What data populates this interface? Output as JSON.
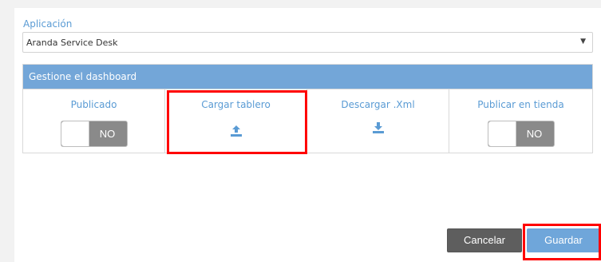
{
  "application": {
    "label": "Aplicación",
    "selected_value": "Aranda Service Desk",
    "arrow": "▼"
  },
  "dashboard_section": {
    "title": "Gestione el dashboard",
    "columns": [
      {
        "label": "Publicado",
        "control": "toggle",
        "toggle_state": "NO"
      },
      {
        "label": "Cargar tablero",
        "control": "icon",
        "icon": "upload-icon"
      },
      {
        "label": "Descargar .Xml",
        "control": "icon",
        "icon": "download-icon"
      },
      {
        "label": "Publicar en tienda",
        "control": "toggle",
        "toggle_state": "NO"
      }
    ]
  },
  "buttons": {
    "cancel": "Cancelar",
    "save": "Guardar"
  },
  "colors": {
    "accent": "#73a6d8",
    "label_blue": "#5a9bd4",
    "cancel_bg": "#5e5e5e",
    "save_bg": "#6fa6da",
    "toggle_bg": "#8a8a8a",
    "highlight": "#ff0000"
  }
}
